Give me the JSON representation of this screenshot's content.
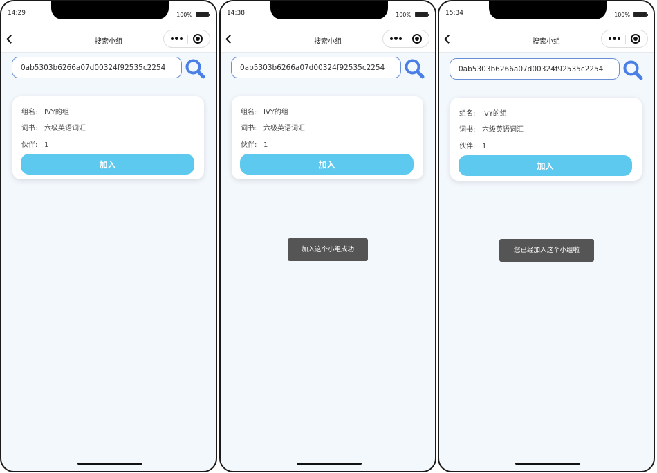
{
  "screens": [
    {
      "time": "14:29",
      "battery": "100%",
      "nav_title": "搜索小组",
      "search_value": "0ab5303b6266a07d00324f92535c2254",
      "card": {
        "name_label": "组名:",
        "name_value": "IVY的组",
        "book_label": "词书:",
        "book_value": "六级英语词汇",
        "partner_label": "伙伴:",
        "partner_value": "1",
        "join_label": "加入"
      },
      "toast": ""
    },
    {
      "time": "14:38",
      "battery": "100%",
      "nav_title": "搜索小组",
      "search_value": "0ab5303b6266a07d00324f92535c2254",
      "card": {
        "name_label": "组名:",
        "name_value": "IVY的组",
        "book_label": "词书:",
        "book_value": "六级英语词汇",
        "partner_label": "伙伴:",
        "partner_value": "1",
        "join_label": "加入"
      },
      "toast": "加入这个小组成功"
    },
    {
      "time": "15:34",
      "battery": "100%",
      "nav_title": "搜索小组",
      "search_value": "0ab5303b6266a07d00324f92535c2254",
      "card": {
        "name_label": "组名:",
        "name_value": "IVY的组",
        "book_label": "词书:",
        "book_value": "六级英语词汇",
        "partner_label": "伙伴:",
        "partner_value": "1",
        "join_label": "加入"
      },
      "toast": "您已经加入这个小组啦"
    }
  ],
  "icons": {
    "back": "chevron-left-icon",
    "more": "more-icon",
    "target": "target-icon",
    "search": "search-icon"
  },
  "colors": {
    "join_button": "#5ec9ef",
    "search_icon": "#4a7fe6",
    "page_background": "#f3f8fd",
    "toast_background": "#555555"
  }
}
